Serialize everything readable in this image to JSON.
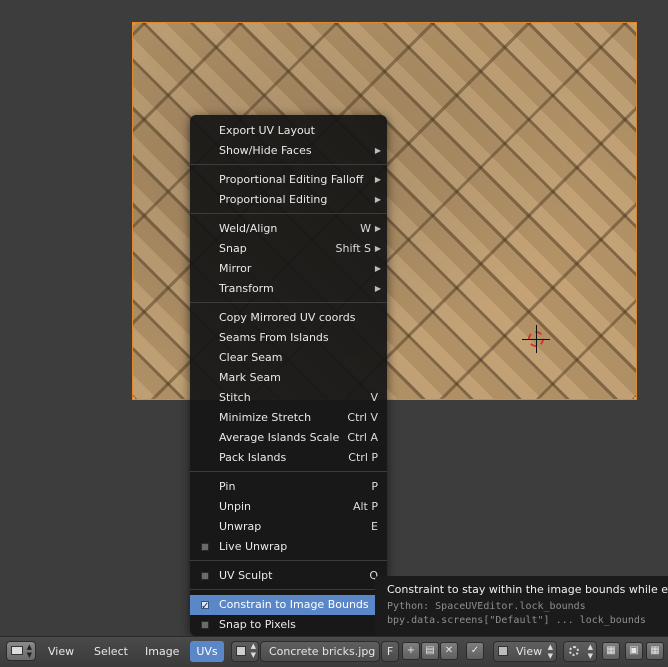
{
  "menu": {
    "items": [
      {
        "label": "Export UV Layout",
        "shortcut": "",
        "submenu": false
      },
      {
        "label": "Show/Hide Faces",
        "shortcut": "",
        "submenu": true
      },
      {
        "label": "Proportional Editing Falloff",
        "shortcut": "",
        "submenu": true
      },
      {
        "label": "Proportional Editing",
        "shortcut": "",
        "submenu": true
      },
      {
        "label": "Weld/Align",
        "shortcut": "W",
        "submenu": true
      },
      {
        "label": "Snap",
        "shortcut": "Shift S",
        "submenu": true
      },
      {
        "label": "Mirror",
        "shortcut": "",
        "submenu": true
      },
      {
        "label": "Transform",
        "shortcut": "",
        "submenu": true
      },
      {
        "label": "Copy Mirrored UV coords",
        "shortcut": "",
        "submenu": false
      },
      {
        "label": "Seams From Islands",
        "shortcut": "",
        "submenu": false
      },
      {
        "label": "Clear Seam",
        "shortcut": "",
        "submenu": false
      },
      {
        "label": "Mark Seam",
        "shortcut": "",
        "submenu": false
      },
      {
        "label": "Stitch",
        "shortcut": "V",
        "submenu": false
      },
      {
        "label": "Minimize Stretch",
        "shortcut": "Ctrl V",
        "submenu": false
      },
      {
        "label": "Average Islands Scale",
        "shortcut": "Ctrl A",
        "submenu": false
      },
      {
        "label": "Pack Islands",
        "shortcut": "Ctrl P",
        "submenu": false
      },
      {
        "label": "Pin",
        "shortcut": "P",
        "submenu": false
      },
      {
        "label": "Unpin",
        "shortcut": "Alt P",
        "submenu": false
      },
      {
        "label": "Unwrap",
        "shortcut": "E",
        "submenu": false
      },
      {
        "label": "Live Unwrap",
        "checked": false
      },
      {
        "label": "UV Sculpt",
        "shortcut": "Q",
        "checked": false
      },
      {
        "label": "Constrain to Image Bounds",
        "checked": true
      },
      {
        "label": "Snap to Pixels",
        "checked": false
      }
    ]
  },
  "tooltip": {
    "title": "Constraint to stay within the image bounds while editing",
    "python": "Python: SpaceUVEditor.lock_bounds",
    "path": "bpy.data.screens[\"Default\"] ... lock_bounds"
  },
  "header": {
    "view": "View",
    "select": "Select",
    "image": "Image",
    "uvs": "UVs",
    "image_name": "Concrete bricks.jpg",
    "fake_user": "F",
    "view_mode": "View"
  },
  "colors": {
    "accent": "#5a87c7",
    "frame": "#e08a2c",
    "menu_bg": "#161616",
    "header_bg": "#474747"
  },
  "icons": {
    "submenu": "triangle-right",
    "checkbox": "square",
    "editor_type": "uv-image-editor-icon"
  }
}
